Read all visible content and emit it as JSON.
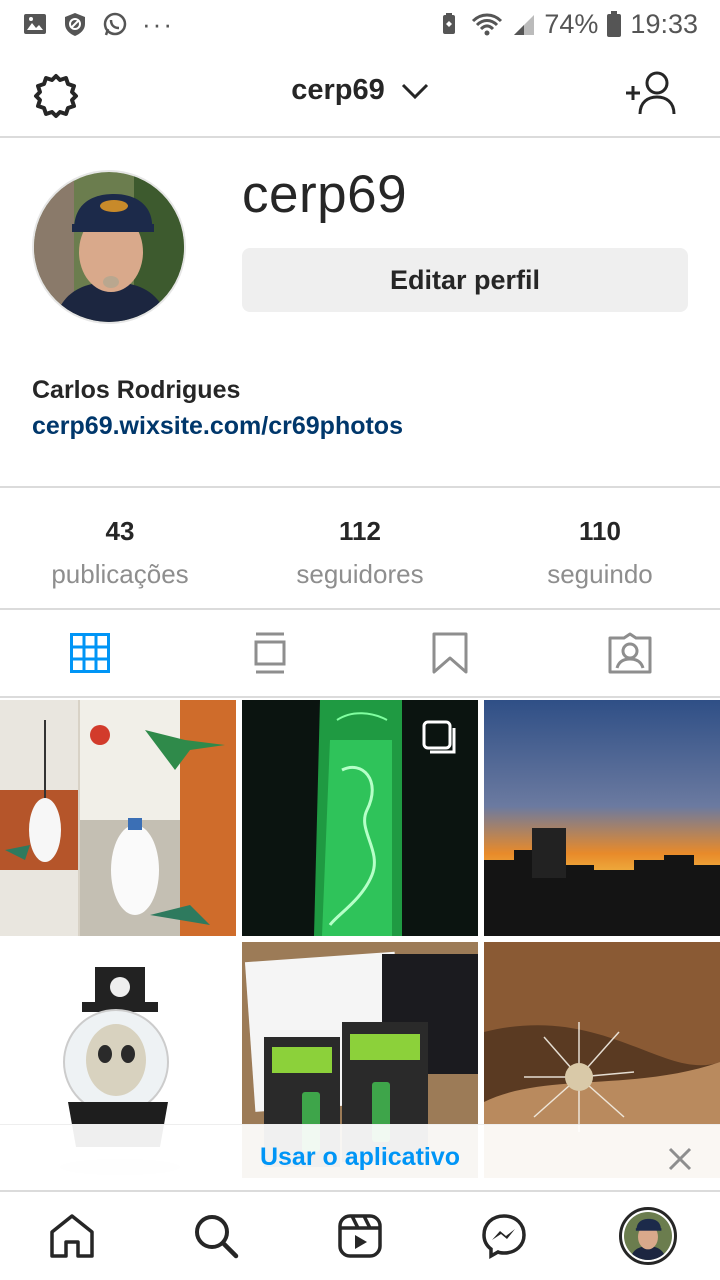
{
  "status_bar": {
    "battery": "74%",
    "time": "19:33",
    "dots": "···"
  },
  "top_nav": {
    "username": "cerp69"
  },
  "profile": {
    "username": "cerp69",
    "edit_button": "Editar perfil",
    "full_name": "Carlos Rodrigues",
    "website": "cerp69.wixsite.com/cr69photos"
  },
  "stats": [
    {
      "value": "43",
      "label": "publicações"
    },
    {
      "value": "112",
      "label": "seguidores"
    },
    {
      "value": "110",
      "label": "seguindo"
    }
  ],
  "tabs": [
    {
      "icon": "grid-icon",
      "active": true
    },
    {
      "icon": "feed-icon",
      "active": false
    },
    {
      "icon": "bookmark-icon",
      "active": false
    },
    {
      "icon": "tagged-icon",
      "active": false
    }
  ],
  "grid_photos": [
    {
      "subject": "bottle-hummingbird-feeders"
    },
    {
      "subject": "green-glowing-bottle-mermaid",
      "multi": true
    },
    {
      "subject": "sunset-over-city"
    },
    {
      "subject": "skull-snow-globe"
    },
    {
      "subject": "rayovac-batteries"
    },
    {
      "subject": "dandelion"
    }
  ],
  "banner": {
    "text": "Usar o aplicativo"
  },
  "accent_color": "#0095f6",
  "link_color": "#00376b"
}
